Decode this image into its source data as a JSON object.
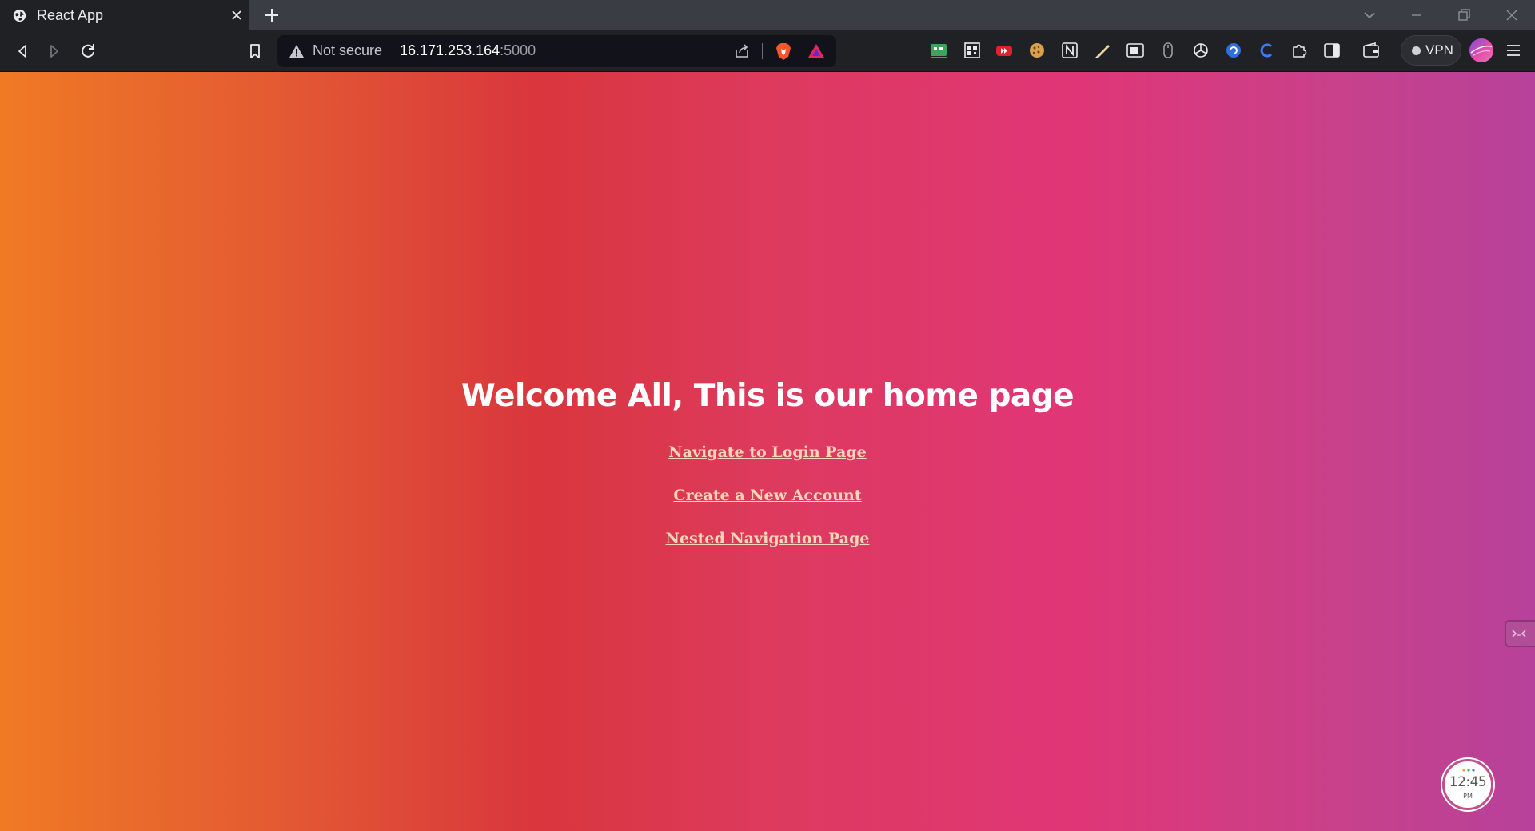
{
  "browser": {
    "tab_title": "React App",
    "security_label": "Not secure",
    "url_host": "16.171.253.164",
    "url_port": ":5000",
    "vpn_label": "VPN"
  },
  "page": {
    "heading": "Welcome All, This is our home page",
    "links": [
      {
        "label": "Navigate to Login Page"
      },
      {
        "label": "Create a New Account"
      },
      {
        "label": "Nested Navigation Page"
      }
    ]
  },
  "clock_widget": {
    "time": "12:45",
    "ampm": "PM"
  },
  "colors": {
    "link": "#f6d6b7",
    "heading": "#ffffff",
    "gradient_left": "#f07a24",
    "gradient_mid": "#d9363d",
    "gradient_right": "#b7419a"
  }
}
